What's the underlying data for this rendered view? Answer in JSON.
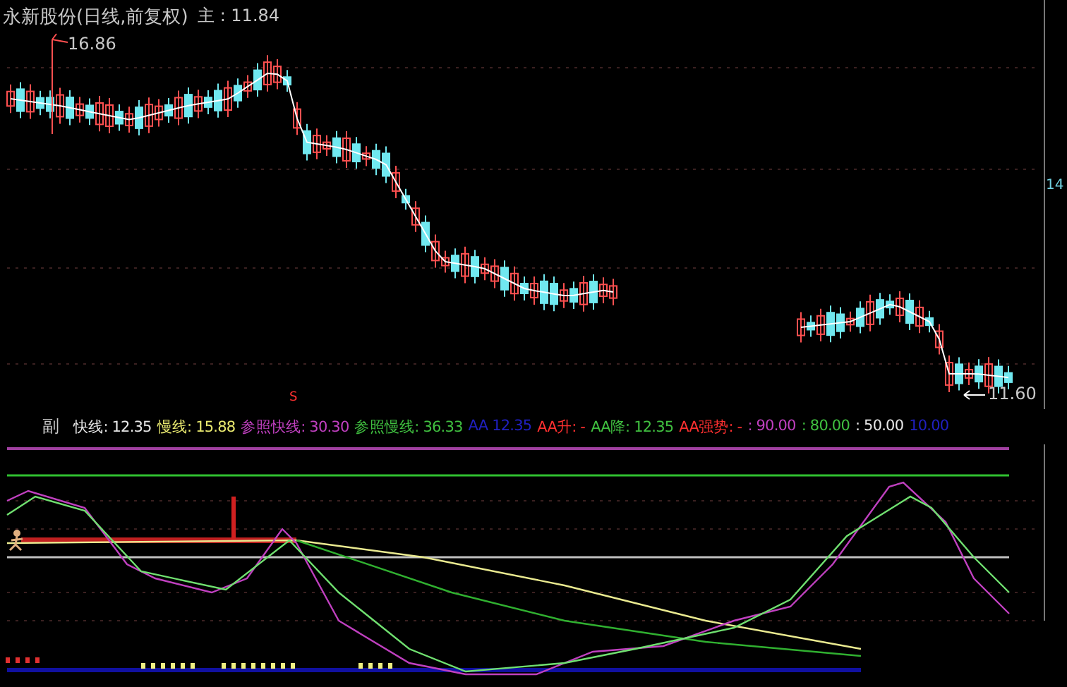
{
  "price_panel": {
    "title": "永新股份(日线,前复权)",
    "main_value": "主 : 11.84",
    "high_label": "16.86",
    "low_label": "11.60",
    "axis_label": "14",
    "signal_mark": "S"
  },
  "indicator_legend": {
    "panel_label": "副",
    "items": [
      {
        "text": "快线: 12.35",
        "color": "#e8e8e8"
      },
      {
        "text": "慢线: 15.88",
        "color": "#eaea70"
      },
      {
        "text": "参照快线: 30.30",
        "color": "#c040c0"
      },
      {
        "text": "参照慢线: 36.33",
        "color": "#40c040"
      },
      {
        "text": "AA 12.35",
        "color": "#2020c0"
      },
      {
        "text": "AA升: -",
        "color": "#ff3030"
      },
      {
        "text": "AA降: 12.35",
        "color": "#40c040"
      },
      {
        "text": "AA强势: -",
        "color": "#ff3030"
      },
      {
        "text": ": 90.00",
        "color": "#c040c0"
      },
      {
        "text": ": 80.00",
        "color": "#40c040"
      },
      {
        "text": ": 50.00",
        "color": "#e8e8e8"
      },
      {
        "text": "10.00",
        "color": "#2020c0"
      }
    ]
  }
}
